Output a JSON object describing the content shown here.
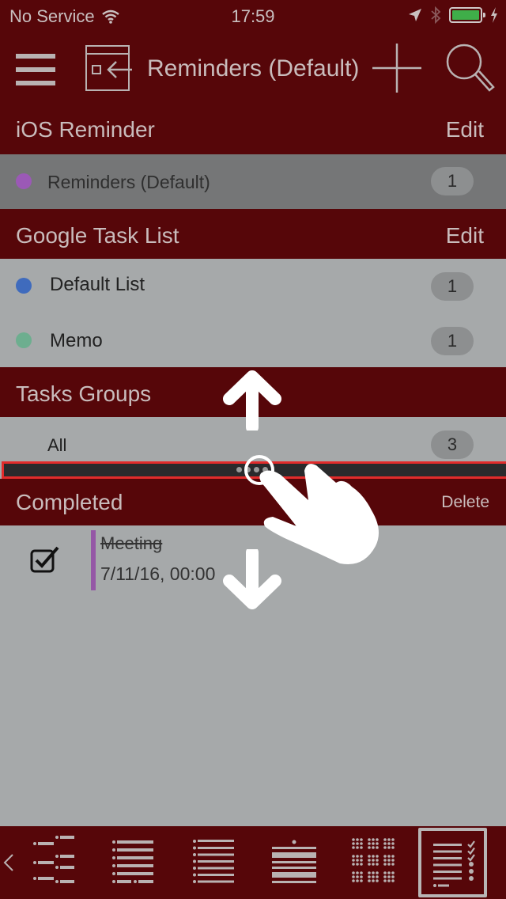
{
  "status_bar": {
    "carrier": "No Service",
    "time": "17:59",
    "battery_level": 1.0,
    "battery_color": "#3fae49",
    "icons": [
      "wifi-icon",
      "location-arrow-icon",
      "bluetooth-icon",
      "battery-icon",
      "charging-bolt-icon"
    ]
  },
  "nav": {
    "title": "Reminders (Default)",
    "icons": [
      "hamburger-menu-icon",
      "switch-list-icon",
      "add-icon",
      "search-icon"
    ]
  },
  "sections": {
    "ios": {
      "title": "iOS Reminder",
      "action": "Edit",
      "items": [
        {
          "label": "Reminders (Default)",
          "count": "1",
          "color": "#9b59b6",
          "selected": true
        }
      ]
    },
    "google": {
      "title": "Google Task List",
      "action": "Edit",
      "items": [
        {
          "label": "Default List",
          "count": "1",
          "color": "#3f6bbd"
        },
        {
          "label": "Memo",
          "count": "1",
          "color": "#6dae8f"
        }
      ]
    },
    "groups": {
      "title": "Tasks Groups",
      "items": [
        {
          "label": "All",
          "count": "3"
        }
      ]
    },
    "completed": {
      "title": "Completed",
      "action": "Delete",
      "tasks": [
        {
          "name": "Meeting",
          "date": "7/11/16, 00:00",
          "checked": true,
          "color": "#9557a6"
        }
      ]
    }
  },
  "toolbar": {
    "back": "<",
    "items": [
      {
        "name": "two-column-list-view-icon"
      },
      {
        "name": "list-view-icon"
      },
      {
        "name": "compact-list-view-icon"
      },
      {
        "name": "timeline-view-icon"
      },
      {
        "name": "grid-view-icon"
      },
      {
        "name": "checklist-view-icon",
        "selected": true
      }
    ]
  },
  "colors": {
    "brand": "#560609",
    "row_bg": "#a6a9aa",
    "selected_row_bg": "#757677",
    "highlight_border": "#e12b2b"
  }
}
